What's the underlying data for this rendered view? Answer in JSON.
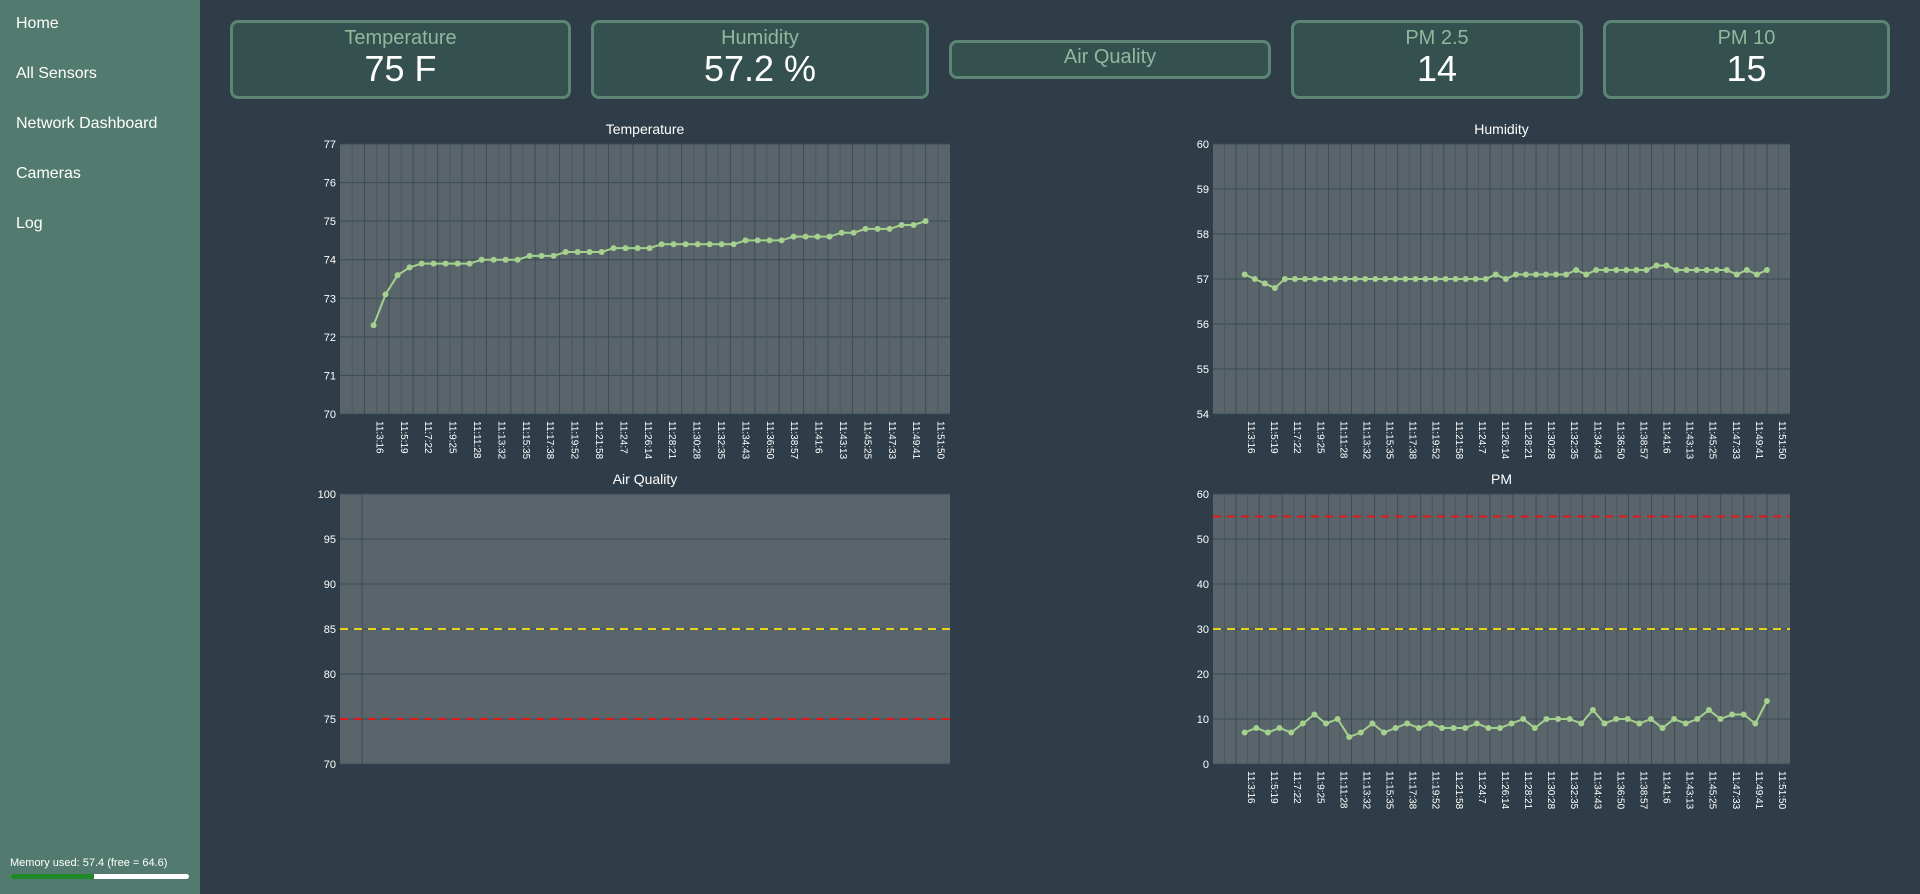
{
  "sidebar": {
    "items": [
      {
        "label": "Home"
      },
      {
        "label": "All Sensors"
      },
      {
        "label": "Network Dashboard"
      },
      {
        "label": "Cameras"
      },
      {
        "label": "Log"
      }
    ],
    "memory": {
      "text": "Memory used: 57.4 (free = 64.6)",
      "fraction": 0.47
    }
  },
  "cards": {
    "temperature": {
      "label": "Temperature",
      "value": "75 F"
    },
    "humidity": {
      "label": "Humidity",
      "value": "57.2 %"
    },
    "air_quality": {
      "label": "Air Quality"
    },
    "pm25": {
      "label": "PM 2.5",
      "value": "14"
    },
    "pm10": {
      "label": "PM 10",
      "value": "15"
    }
  },
  "colors": {
    "background": "#2e3d47",
    "sidebar": "#527a6f",
    "plot_bg": "#5a646b",
    "series": "#a5d18e",
    "threshold_yellow": "#e8d21c",
    "threshold_red": "#e01818"
  },
  "chart_data": [
    {
      "type": "line",
      "title": "Temperature",
      "ylim": [
        70,
        77
      ],
      "yticks": [
        70,
        71,
        72,
        73,
        74,
        75,
        76,
        77
      ],
      "categories": [
        "11:3:16",
        "11:5:19",
        "11:7:22",
        "11:9:25",
        "11:11:28",
        "11:13:32",
        "11:15:35",
        "11:17:38",
        "11:19:52",
        "11:21:58",
        "11:24:7",
        "11:26:14",
        "11:28:21",
        "11:30:28",
        "11:32:35",
        "11:34:43",
        "11:36:50",
        "11:38:57",
        "11:41:6",
        "11:43:13",
        "11:45:25",
        "11:47:33",
        "11:49:41",
        "11:51:50"
      ],
      "series": [
        {
          "values": [
            72.3,
            73.1,
            73.6,
            73.8,
            73.9,
            73.9,
            73.9,
            73.9,
            73.9,
            74.0,
            74.0,
            74.0,
            74.0,
            74.1,
            74.1,
            74.1,
            74.2,
            74.2,
            74.2,
            74.2,
            74.3,
            74.3,
            74.3,
            74.3,
            74.4,
            74.4,
            74.4,
            74.4,
            74.4,
            74.4,
            74.4,
            74.5,
            74.5,
            74.5,
            74.5,
            74.6,
            74.6,
            74.6,
            74.6,
            74.7,
            74.7,
            74.8,
            74.8,
            74.8,
            74.9,
            74.9,
            75.0
          ]
        }
      ],
      "grid": true
    },
    {
      "type": "line",
      "title": "Humidity",
      "ylim": [
        54,
        60
      ],
      "yticks": [
        54,
        55,
        56,
        57,
        58,
        59,
        60
      ],
      "categories": [
        "11:3:16",
        "11:5:19",
        "11:7:22",
        "11:9:25",
        "11:11:28",
        "11:13:32",
        "11:15:35",
        "11:17:38",
        "11:19:52",
        "11:21:58",
        "11:24:7",
        "11:26:14",
        "11:28:21",
        "11:30:28",
        "11:32:35",
        "11:34:43",
        "11:36:50",
        "11:38:57",
        "11:41:6",
        "11:43:13",
        "11:45:25",
        "11:47:33",
        "11:49:41",
        "11:51:50"
      ],
      "series": [
        {
          "values": [
            57.1,
            57.0,
            56.9,
            56.8,
            57.0,
            57.0,
            57.0,
            57.0,
            57.0,
            57.0,
            57.0,
            57.0,
            57.0,
            57.0,
            57.0,
            57.0,
            57.0,
            57.0,
            57.0,
            57.0,
            57.0,
            57.0,
            57.0,
            57.0,
            57.0,
            57.1,
            57.0,
            57.1,
            57.1,
            57.1,
            57.1,
            57.1,
            57.1,
            57.2,
            57.1,
            57.2,
            57.2,
            57.2,
            57.2,
            57.2,
            57.2,
            57.3,
            57.3,
            57.2,
            57.2,
            57.2,
            57.2,
            57.2,
            57.2,
            57.1,
            57.2,
            57.1,
            57.2
          ]
        }
      ],
      "grid": true
    },
    {
      "type": "line",
      "title": "Air Quality",
      "ylim": [
        70,
        100
      ],
      "yticks": [
        70,
        75,
        80,
        85,
        90,
        95,
        100
      ],
      "categories": [],
      "series": [],
      "thresholds": [
        {
          "value": 85,
          "color": "#e8d21c"
        },
        {
          "value": 75,
          "color": "#e01818"
        }
      ],
      "grid": true
    },
    {
      "type": "line",
      "title": "PM",
      "ylim": [
        0,
        60
      ],
      "yticks": [
        0,
        10,
        20,
        30,
        40,
        50,
        60
      ],
      "categories": [
        "11:3:16",
        "11:5:19",
        "11:7:22",
        "11:9:25",
        "11:11:28",
        "11:13:32",
        "11:15:35",
        "11:17:38",
        "11:19:52",
        "11:21:58",
        "11:24:7",
        "11:26:14",
        "11:28:21",
        "11:30:28",
        "11:32:35",
        "11:34:43",
        "11:36:50",
        "11:38:57",
        "11:41:6",
        "11:43:13",
        "11:45:25",
        "11:47:33",
        "11:49:41",
        "11:51:50"
      ],
      "series": [
        {
          "values": [
            7,
            8,
            7,
            8,
            7,
            9,
            11,
            9,
            10,
            6,
            7,
            9,
            7,
            8,
            9,
            8,
            9,
            8,
            8,
            8,
            9,
            8,
            8,
            9,
            10,
            8,
            10,
            10,
            10,
            9,
            12,
            9,
            10,
            10,
            9,
            10,
            8,
            10,
            9,
            10,
            12,
            10,
            11,
            11,
            9,
            14
          ]
        }
      ],
      "thresholds": [
        {
          "value": 55,
          "color": "#e01818"
        },
        {
          "value": 30,
          "color": "#e8d21c"
        }
      ],
      "grid": true
    }
  ]
}
